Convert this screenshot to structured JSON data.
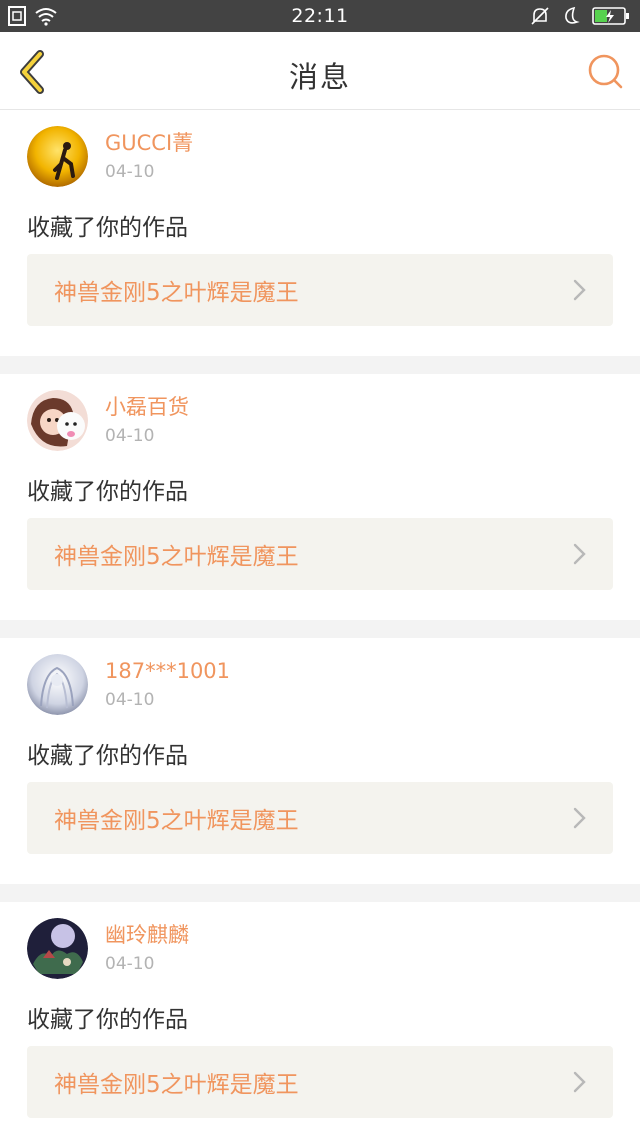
{
  "status_bar": {
    "time": "22:11"
  },
  "header": {
    "title": "消息"
  },
  "messages": [
    {
      "username": "GUCCI菁",
      "date": "04-10",
      "action": "收藏了你的作品",
      "work_title": "神兽金刚5之叶辉是魔王"
    },
    {
      "username": "小磊百货",
      "date": "04-10",
      "action": "收藏了你的作品",
      "work_title": "神兽金刚5之叶辉是魔王"
    },
    {
      "username": "187***1001",
      "date": "04-10",
      "action": "收藏了你的作品",
      "work_title": "神兽金刚5之叶辉是魔王"
    },
    {
      "username": "幽玲麒麟",
      "date": "04-10",
      "action": "收藏了你的作品",
      "work_title": "神兽金刚5之叶辉是魔王"
    }
  ],
  "colors": {
    "accent": "#f0955e",
    "status_bar_bg": "#434343",
    "work_bg": "#f4f3ee"
  }
}
